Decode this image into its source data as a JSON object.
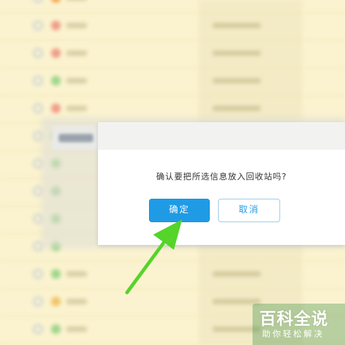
{
  "dialog": {
    "message": "确认要把所选信息放入回收站吗?",
    "confirm_label": "确定",
    "cancel_label": "取消"
  },
  "watermark": {
    "title": "百科全说",
    "subtitle": "助你轻松解决"
  },
  "colors": {
    "background": "#fbf3cf",
    "primary": "#1f9be6",
    "arrow": "#55d42a"
  }
}
